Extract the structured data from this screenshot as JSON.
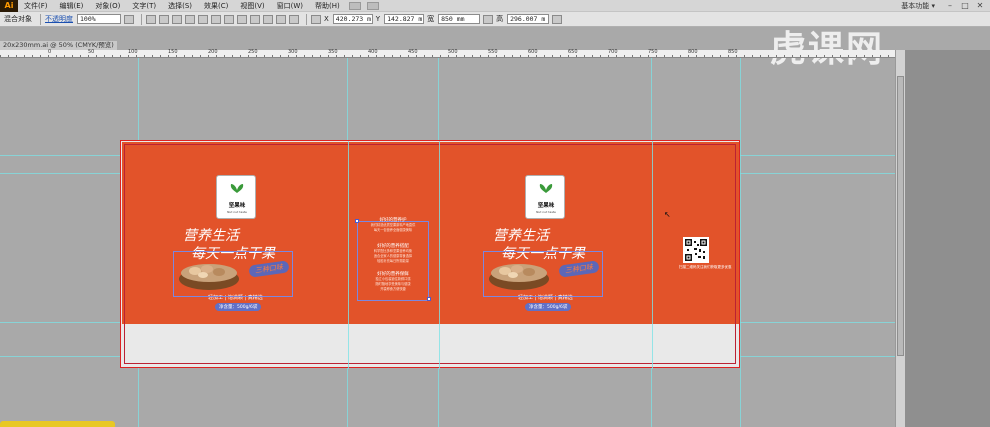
{
  "app": {
    "logo": "Ai",
    "workspace": "基本功能 ▾"
  },
  "menu": [
    "文件(F)",
    "编辑(E)",
    "对象(O)",
    "文字(T)",
    "选择(S)",
    "效果(C)",
    "视图(V)",
    "窗口(W)",
    "帮助(H)"
  ],
  "window_controls": [
    "–",
    "□",
    "✕"
  ],
  "control_bar": {
    "mode_label": "混合对象",
    "opacity_label": "不透明度",
    "opacity_value": "100%",
    "x_label": "X",
    "x_value": "420.273 m",
    "y_label": "Y",
    "y_value": "142.827 m",
    "w_label": "宽",
    "w_value": "850 mm",
    "h_label": "高",
    "h_value": "296.007 m"
  },
  "document_tab": "20x230mm.ai @ 50% (CMYK/预览)",
  "ruler": {
    "labels": [
      "0",
      "50",
      "100",
      "150",
      "200",
      "250",
      "300",
      "350",
      "400",
      "450",
      "500",
      "550",
      "600",
      "650",
      "700",
      "750",
      "800",
      "850"
    ]
  },
  "watermark": "虎课网",
  "design": {
    "colors": {
      "orange": "#e2532a",
      "badge": "#5c67b8",
      "logo_leaf": "#3a9a3a"
    },
    "logo_name": "坚果味",
    "logo_sub": "Nut nut taste",
    "slogan_line1": "营养生活",
    "slogan_line2": "每天一点干果",
    "badge_text": "三种口味",
    "features": "轻加工 | 饱满颗 | 真精选",
    "weight_text": "净含量：500g/6袋",
    "info_blocks": [
      {
        "title": "好好的营养护",
        "lines": [
          "我们精选优质坚果原料产地直供",
          "每天一包营养全面健康美味"
        ]
      },
      {
        "title": "好好的营养搭配",
        "lines": [
          "科学配比多种坚果营养均衡",
          "适合全家人的健康零食选择",
          "轻松补充每日所需能量"
        ]
      },
      {
        "title": "好好的营养保鲜",
        "lines": [
          "独立小包装锁住新鲜口感",
          "随时随地享受美味与健康",
          "开袋即食方便快捷"
        ]
      }
    ],
    "qr_caption": "扫描二维码关注我们获取更多优惠"
  }
}
